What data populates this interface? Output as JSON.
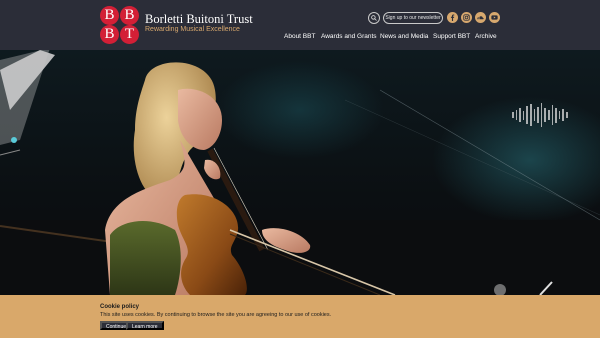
{
  "brand": {
    "logo_letters": [
      "B",
      "B",
      "B",
      "T"
    ],
    "name": "Borletti Buitoni Trust",
    "tagline": "Rewarding Musical Excellence"
  },
  "header_actions": {
    "newsletter_label": "Sign up to our newsletter",
    "social_icons": [
      "facebook-icon",
      "instagram-icon",
      "soundcloud-icon",
      "youtube-icon"
    ]
  },
  "nav": {
    "items": [
      "About BBT",
      "Awards and Grants",
      "News and Media",
      "Support BBT",
      "Archive"
    ]
  },
  "hero": {
    "audio_indicator": "sound-bars-icon"
  },
  "cookie": {
    "title": "Cookie policy",
    "text": "This site uses cookies. By continuing to browse the site you are agreeing to our use of cookies.",
    "continue_label": "Continue",
    "learn_more_label": "Learn more"
  },
  "colors": {
    "header_bg": "#2b2d38",
    "accent_gold": "#d7a86e",
    "logo_red": "#d31f36",
    "cookie_bg": "#d9a86a"
  }
}
